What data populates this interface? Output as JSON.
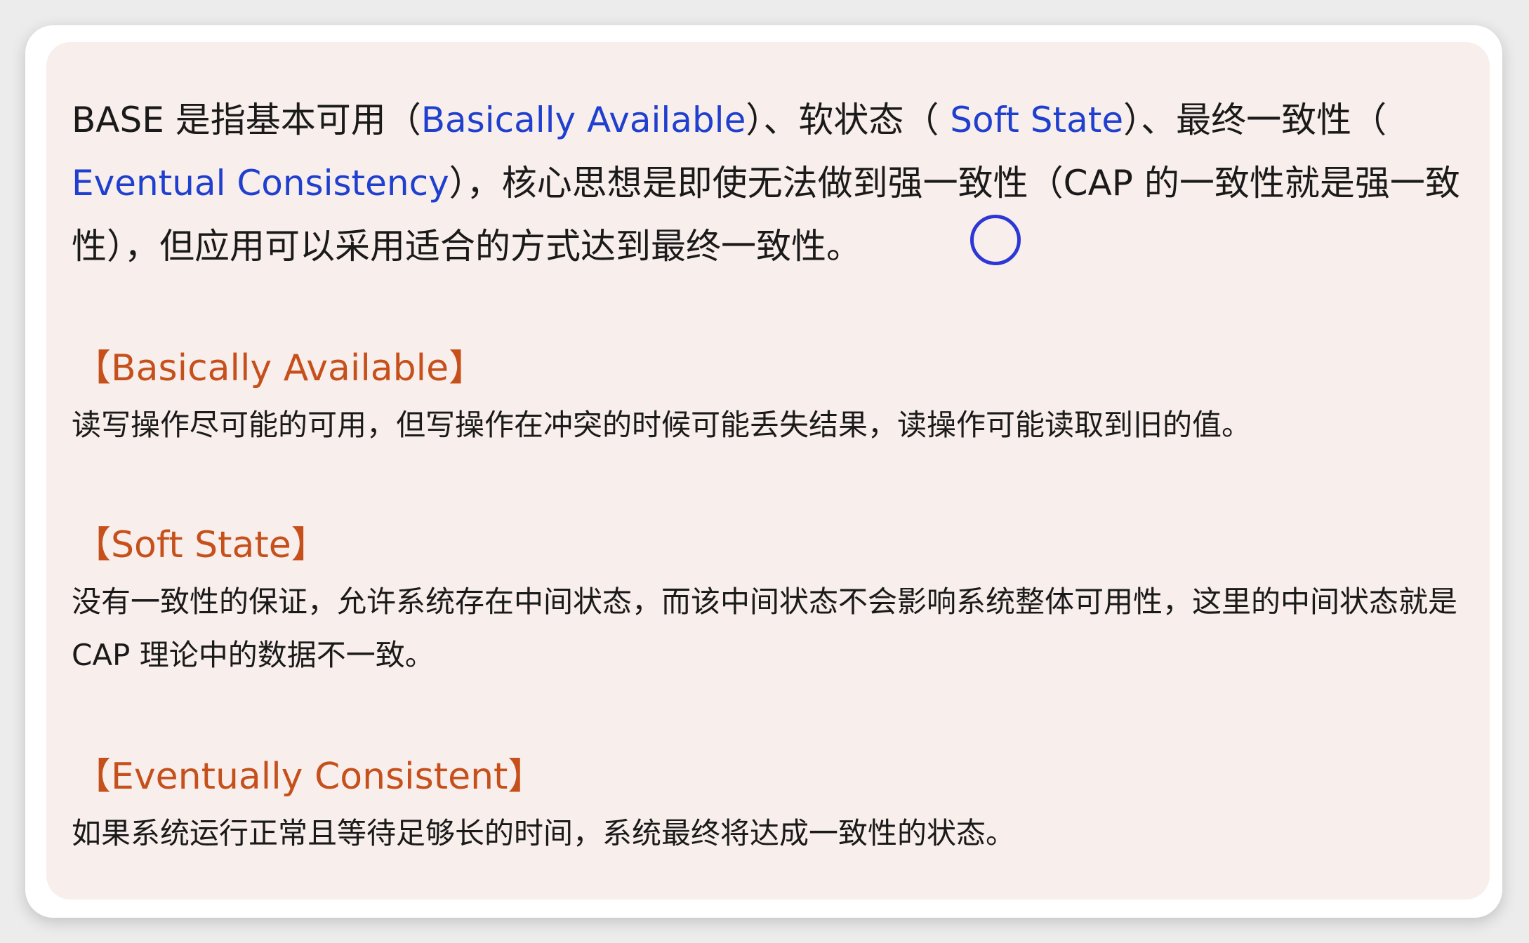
{
  "intro": {
    "p1": "BASE 是指基本可用（",
    "term1": "Basically Available",
    "p2": "）、软状态（ ",
    "term2": "Soft State",
    "p3": "）、最终一致性（ ",
    "term3": "Eventual Consistency",
    "p4": "），核心思想是即使无法做到强一致性（CAP 的一致性就是强一致性），但应用可以采用适合的方式达到最终一致性。"
  },
  "sections": [
    {
      "title": "【Basically Available】",
      "body": "读写操作尽可能的可用，但写操作在冲突的时候可能丢失结果，读操作可能读取到旧的值。"
    },
    {
      "title": "【Soft State】",
      "body": "没有一致性的保证，允许系统存在中间状态，而该中间状态不会影响系统整体可用性，这里的中间状态就是 CAP 理论中的数据不一致。"
    },
    {
      "title": "【Eventually Consistent】",
      "body": "如果系统运行正常且等待足够长的时间，系统最终将达成一致性的状态。"
    }
  ],
  "colors": {
    "term_blue": "#1f3fcf",
    "heading_orange": "#c6501b",
    "card_background": "#f8eeeb"
  }
}
